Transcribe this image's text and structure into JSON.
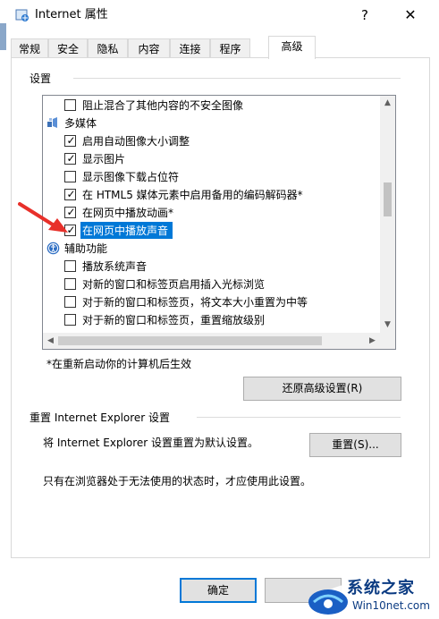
{
  "window": {
    "title": "Internet 属性",
    "help_glyph": "?",
    "close_glyph": "✕"
  },
  "tabs": [
    {
      "label": "常规"
    },
    {
      "label": "安全"
    },
    {
      "label": "隐私"
    },
    {
      "label": "内容"
    },
    {
      "label": "连接"
    },
    {
      "label": "程序"
    },
    {
      "label": "高级",
      "active": true
    }
  ],
  "settings": {
    "group_title": "设置",
    "items": [
      {
        "kind": "option",
        "label": "阻止混合了其他内容的不安全图像",
        "checked": false
      },
      {
        "kind": "category",
        "label": "多媒体",
        "icon": "multimedia-icon"
      },
      {
        "kind": "option",
        "label": "启用自动图像大小调整",
        "checked": true
      },
      {
        "kind": "option",
        "label": "显示图片",
        "checked": true
      },
      {
        "kind": "option",
        "label": "显示图像下载占位符",
        "checked": false
      },
      {
        "kind": "option",
        "label": "在 HTML5 媒体元素中启用备用的编码解码器*",
        "checked": true
      },
      {
        "kind": "option",
        "label": "在网页中播放动画*",
        "checked": true
      },
      {
        "kind": "option",
        "label": "在网页中播放声音",
        "checked": true,
        "selected": true
      },
      {
        "kind": "category",
        "label": "辅助功能",
        "icon": "accessibility-icon"
      },
      {
        "kind": "option",
        "label": "播放系统声音",
        "checked": false
      },
      {
        "kind": "option",
        "label": "对新的窗口和标签页启用插入光标浏览",
        "checked": false
      },
      {
        "kind": "option",
        "label": "对于新的窗口和标签页，将文本大小重置为中等",
        "checked": false
      },
      {
        "kind": "option",
        "label": "对于新的窗口和标签页，重置缩放级别",
        "checked": false
      }
    ],
    "restart_note": "*在重新启动你的计算机后生效",
    "restore_button": "还原高级设置(R)"
  },
  "reset": {
    "group_title": "重置 Internet Explorer 设置",
    "description": "将 Internet Explorer 设置重置为默认设置。",
    "button": "重置(S)...",
    "warning": "只有在浏览器处于无法使用的状态时，才应使用此设置。"
  },
  "footer": {
    "ok_button": "确定"
  },
  "watermark": {
    "brand": "系统之家",
    "site": "Win10net.com"
  },
  "colors": {
    "selection": "#0078d7",
    "annotation_arrow": "#e8302a"
  }
}
